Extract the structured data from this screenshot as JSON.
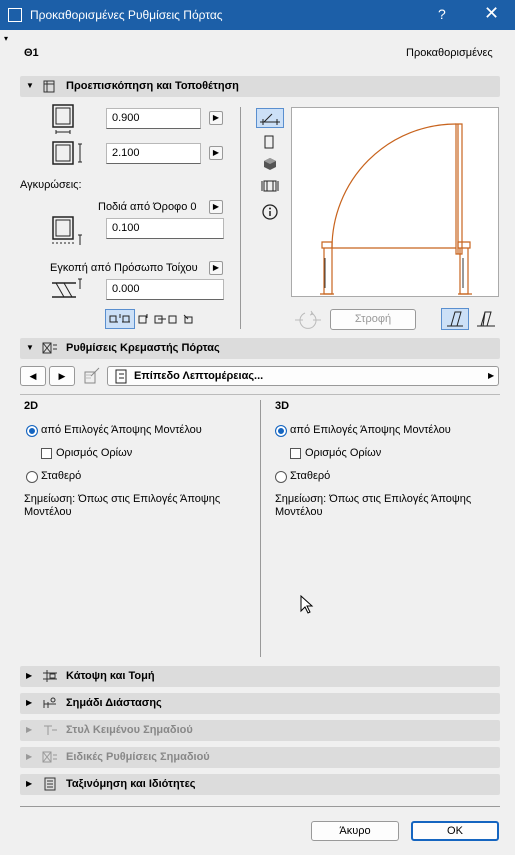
{
  "window": {
    "title": "Προκαθορισμένες Ρυθμίσεις Πόρτας",
    "help": "?",
    "close": "✕"
  },
  "header": {
    "id": "Θ1",
    "preset": "Προκαθορισμένες"
  },
  "preview_section": {
    "label": "Προεπισκόπηση και Τοποθέτηση",
    "width_value": "0.900",
    "height_value": "2.100",
    "anchors_label": "Αγκυρώσεις:",
    "sill_dropdown": "Ποδιά από Όροφο 0",
    "sill_value": "0.100",
    "reveal_dropdown": "Εγκοπή από Πρόσωπο Τοίχου",
    "reveal_value": "0.000",
    "rotate_label": "Στροφή"
  },
  "hanger_section": {
    "label": "Ρυθμίσεις Κρεμαστής Πόρτας",
    "detail_level": "Επίπεδο Λεπτομέρειας...",
    "col2d": {
      "title": "2D",
      "radio1": "από Επιλογές Άποψης Μοντέλου",
      "check": "Ορισμός Ορίων",
      "radio2": "Σταθερό",
      "note": "Σημείωση: Όπως στις Επιλογές Άποψης Μοντέλου"
    },
    "col3d": {
      "title": "3D",
      "radio1": "από Επιλογές Άποψης Μοντέλου",
      "check": "Ορισμός Ορίων",
      "radio2": "Σταθερό",
      "note": "Σημείωση: Όπως στις Επιλογές Άποψης Μοντέλου"
    }
  },
  "collapsed_sections": [
    {
      "label": "Κάτοψη και Τομή",
      "enabled": true
    },
    {
      "label": "Σημάδι Διάστασης",
      "enabled": true
    },
    {
      "label": "Στυλ Κειμένου Σημαδιού",
      "enabled": false
    },
    {
      "label": "Ειδικές Ρυθμίσεις Σημαδιού",
      "enabled": false
    },
    {
      "label": "Ταξινόμηση και Ιδιότητες",
      "enabled": true
    }
  ],
  "footer": {
    "cancel": "Άκυρο",
    "ok": "OK"
  },
  "colors": {
    "titlebar": "#1c5fa8",
    "accent": "#1565c0",
    "door_line": "#c8641e"
  }
}
